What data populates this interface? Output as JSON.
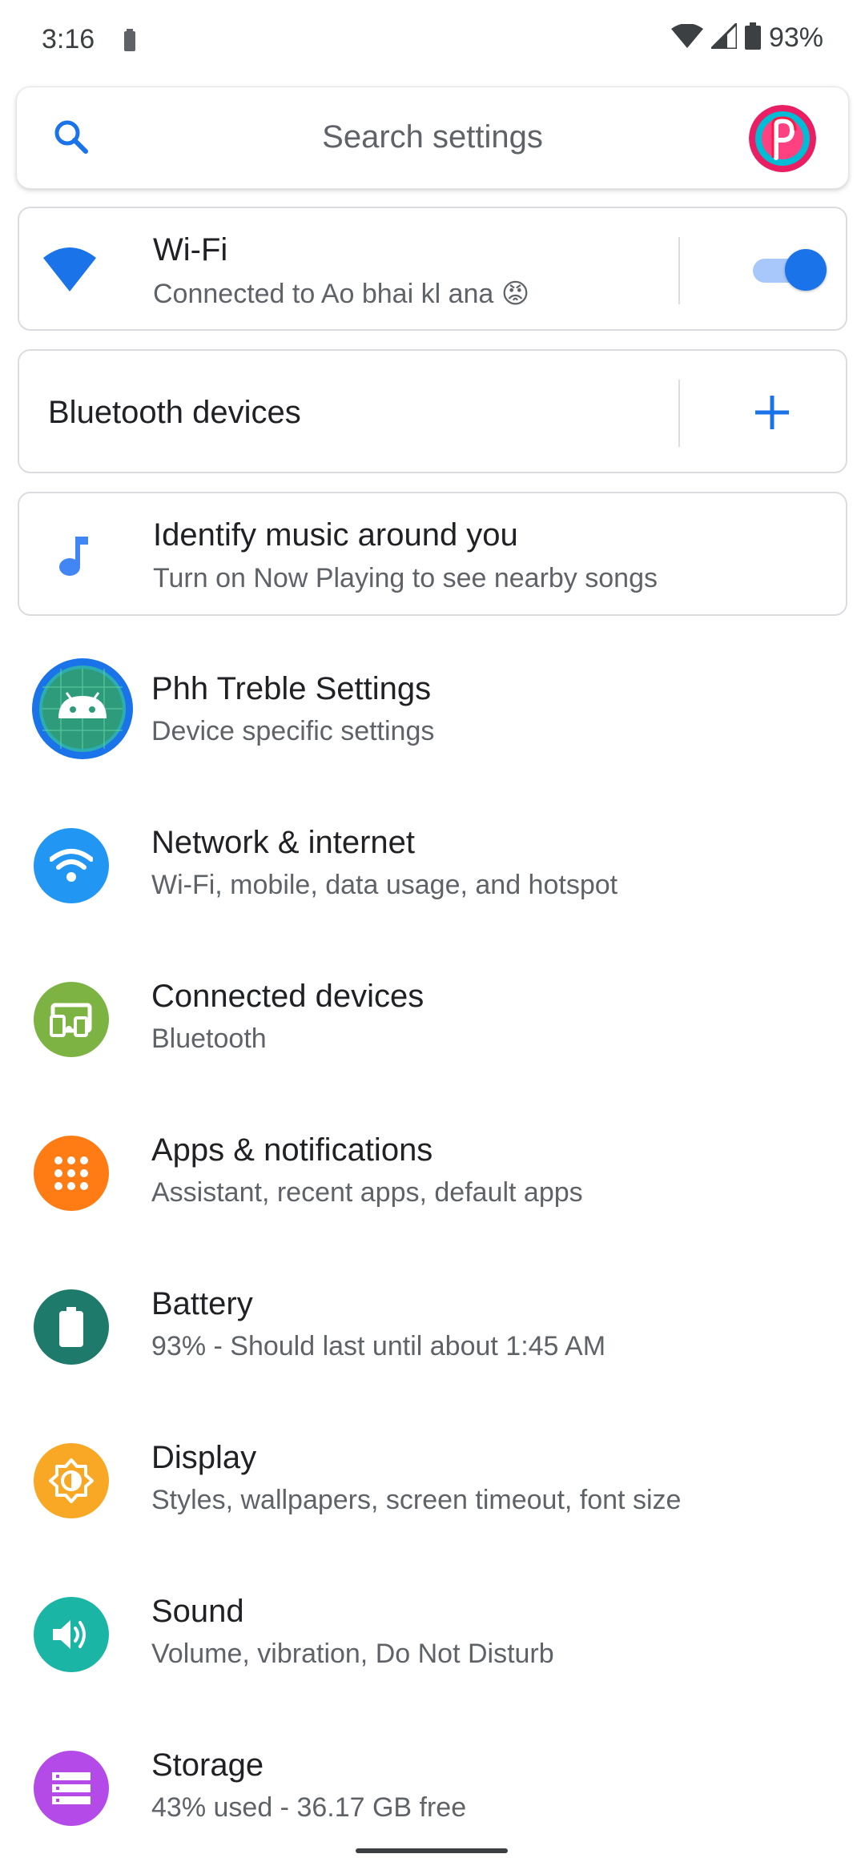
{
  "status": {
    "time": "3:16",
    "battery_pct": "93%"
  },
  "search": {
    "placeholder": "Search settings"
  },
  "wifi_card": {
    "title": "Wi-Fi",
    "subtitle": "Connected to Ao bhai kl ana 😡",
    "toggle_on": true
  },
  "bluetooth_card": {
    "title": "Bluetooth devices"
  },
  "music_card": {
    "title": "Identify music around you",
    "subtitle": "Turn on Now Playing to see nearby songs"
  },
  "items": [
    {
      "title": "Phh Treble Settings",
      "subtitle": "Device specific settings",
      "icon": "android-icon",
      "color": "#1a73e8"
    },
    {
      "title": "Network & internet",
      "subtitle": "Wi-Fi, mobile, data usage, and hotspot",
      "icon": "wifi-icon",
      "color": "#2196f3"
    },
    {
      "title": "Connected devices",
      "subtitle": "Bluetooth",
      "icon": "devices-icon",
      "color": "#7cb342"
    },
    {
      "title": "Apps & notifications",
      "subtitle": "Assistant, recent apps, default apps",
      "icon": "apps-grid-icon",
      "color": "#ff7b14"
    },
    {
      "title": "Battery",
      "subtitle": "93% - Should last until about 1:45 AM",
      "icon": "battery-icon",
      "color": "#1e7b6c"
    },
    {
      "title": "Display",
      "subtitle": "Styles, wallpapers, screen timeout, font size",
      "icon": "brightness-icon",
      "color": "#f9a825"
    },
    {
      "title": "Sound",
      "subtitle": "Volume, vibration, Do Not Disturb",
      "icon": "volume-icon",
      "color": "#1bb5a5"
    },
    {
      "title": "Storage",
      "subtitle": "43% used - 36.17 GB free",
      "icon": "storage-icon",
      "color": "#b44ae8"
    }
  ]
}
